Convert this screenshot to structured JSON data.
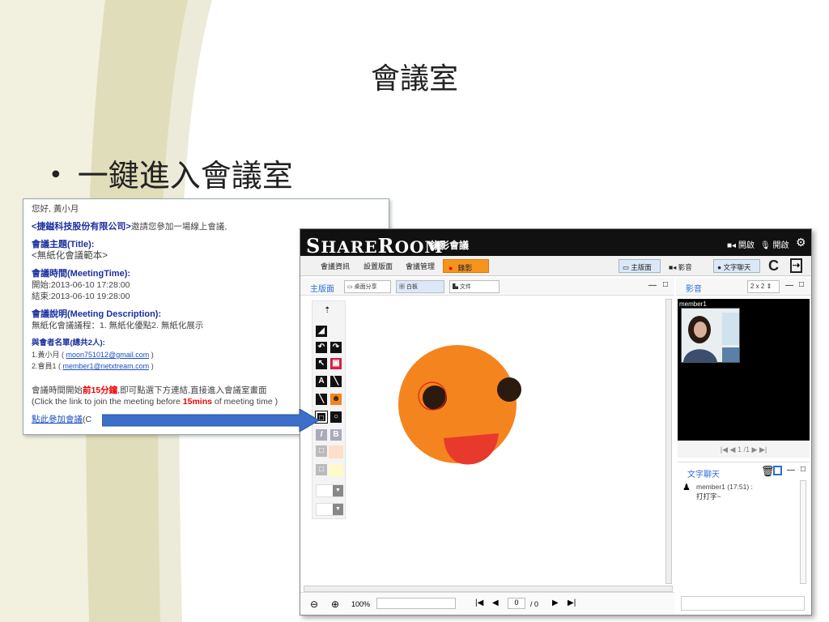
{
  "slide": {
    "title": "會議室",
    "bullet": "一鍵進入會議室",
    "bullet_marker": "•"
  },
  "email": {
    "greeting": "您好, 黃小月",
    "company": "<捷鎰科技股份有限公司>",
    "invite_text": "邀請您參加一場線上會議,",
    "subject_label": "會議主題(Title):",
    "subject_value": "<無紙化會議範本>",
    "time_label": "會議時間(MeetingTime):",
    "start": "開始:2013-06-10 17:28:00",
    "end": "結束:2013-06-10 19:28:00",
    "desc_label": "會議說明(Meeting Description):",
    "desc_value": "無紙化會議議程：1. 無紙化優點2. 無紙化展示",
    "attendees_label": "與會者名單(總共2人):",
    "attendee1_prefix": "1.黃小月 ( ",
    "attendee1_email": "moon751012@gmail.com",
    "attendee1_suffix": " )",
    "attendee2_prefix": "2.會員1 ( ",
    "attendee2_email": "member1@netxtream.com",
    "attendee2_suffix": " )",
    "notice_cn_a": "會議時間開始",
    "notice_cn_red": "前15分鐘",
    "notice_cn_b": ",即可點選下方連結,直接進入會議室畫面",
    "notice_en_a": "(Click the link to join the meeting before ",
    "notice_en_red": "15mins",
    "notice_en_b": " of meeting time )",
    "join_link": "點此參加會議",
    "join_suffix": "(C"
  },
  "app": {
    "logo_s": "S",
    "logo_hare": "HARE",
    "logo_r": "R",
    "logo_oom": "OOM",
    "subtitle": "錄影會議",
    "cam_toggle": "開啟",
    "mic_toggle": "開啟",
    "menu": [
      "會議資訊",
      "設置版面",
      "會議管理"
    ],
    "record_label": "錄影",
    "record_dot": "●",
    "right_buttons": [
      "主版面",
      "影音",
      "文字聊天"
    ],
    "main_panel_title": "主版面",
    "main_tabs": [
      "桌面分享",
      "白板",
      "文件"
    ],
    "video_panel_title": "影音",
    "video_layout": "2 x 2",
    "video_member": "member1",
    "video_pager": "1 /1",
    "chat_title": "文字聊天",
    "chat_user": "member1 (17:51) :",
    "chat_message": "打打字~",
    "zoom": "100%",
    "page_current": "0",
    "page_total": "/ 0",
    "window_controls": [
      "—",
      "□"
    ]
  },
  "colors": {
    "accent_blue": "#2a6fd6",
    "record_orange": "#f7941d",
    "smiley_orange": "#f4841e",
    "mouth_red": "#e83a2c",
    "arrow_blue": "#3b6fc9"
  }
}
